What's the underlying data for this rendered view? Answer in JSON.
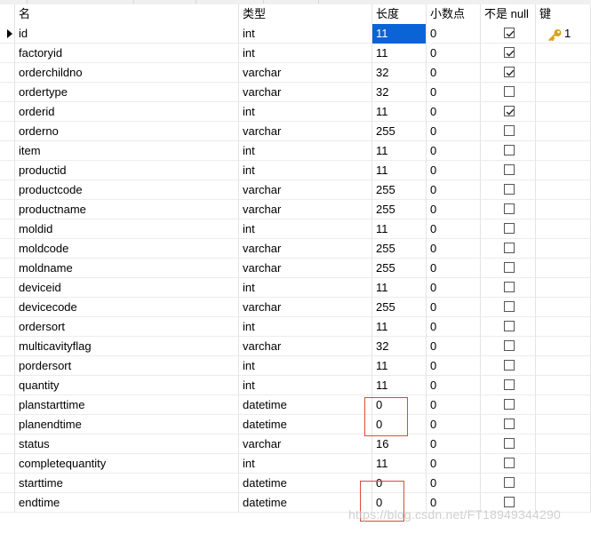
{
  "columns": {
    "name": "名",
    "type": "类型",
    "length": "长度",
    "decimals": "小数点",
    "not_null": "不是 null",
    "key": "键"
  },
  "fields": [
    {
      "name": "id",
      "type": "int",
      "length": "11",
      "decimals": "0",
      "not_null": true,
      "key": "1",
      "selected": true
    },
    {
      "name": "factoryid",
      "type": "int",
      "length": "11",
      "decimals": "0",
      "not_null": true,
      "key": ""
    },
    {
      "name": "orderchildno",
      "type": "varchar",
      "length": "32",
      "decimals": "0",
      "not_null": true,
      "key": ""
    },
    {
      "name": "ordertype",
      "type": "varchar",
      "length": "32",
      "decimals": "0",
      "not_null": false,
      "key": ""
    },
    {
      "name": "orderid",
      "type": "int",
      "length": "11",
      "decimals": "0",
      "not_null": true,
      "key": ""
    },
    {
      "name": "orderno",
      "type": "varchar",
      "length": "255",
      "decimals": "0",
      "not_null": false,
      "key": ""
    },
    {
      "name": "item",
      "type": "int",
      "length": "11",
      "decimals": "0",
      "not_null": false,
      "key": ""
    },
    {
      "name": "productid",
      "type": "int",
      "length": "11",
      "decimals": "0",
      "not_null": false,
      "key": ""
    },
    {
      "name": "productcode",
      "type": "varchar",
      "length": "255",
      "decimals": "0",
      "not_null": false,
      "key": ""
    },
    {
      "name": "productname",
      "type": "varchar",
      "length": "255",
      "decimals": "0",
      "not_null": false,
      "key": ""
    },
    {
      "name": "moldid",
      "type": "int",
      "length": "11",
      "decimals": "0",
      "not_null": false,
      "key": ""
    },
    {
      "name": "moldcode",
      "type": "varchar",
      "length": "255",
      "decimals": "0",
      "not_null": false,
      "key": ""
    },
    {
      "name": "moldname",
      "type": "varchar",
      "length": "255",
      "decimals": "0",
      "not_null": false,
      "key": ""
    },
    {
      "name": "deviceid",
      "type": "int",
      "length": "11",
      "decimals": "0",
      "not_null": false,
      "key": ""
    },
    {
      "name": "devicecode",
      "type": "varchar",
      "length": "255",
      "decimals": "0",
      "not_null": false,
      "key": ""
    },
    {
      "name": "ordersort",
      "type": "int",
      "length": "11",
      "decimals": "0",
      "not_null": false,
      "key": ""
    },
    {
      "name": "multicavityflag",
      "type": "varchar",
      "length": "32",
      "decimals": "0",
      "not_null": false,
      "key": ""
    },
    {
      "name": "pordersort",
      "type": "int",
      "length": "11",
      "decimals": "0",
      "not_null": false,
      "key": ""
    },
    {
      "name": "quantity",
      "type": "int",
      "length": "11",
      "decimals": "0",
      "not_null": false,
      "key": ""
    },
    {
      "name": "planstarttime",
      "type": "datetime",
      "length": "0",
      "decimals": "0",
      "not_null": false,
      "key": ""
    },
    {
      "name": "planendtime",
      "type": "datetime",
      "length": "0",
      "decimals": "0",
      "not_null": false,
      "key": ""
    },
    {
      "name": "status",
      "type": "varchar",
      "length": "16",
      "decimals": "0",
      "not_null": false,
      "key": ""
    },
    {
      "name": "completequantity",
      "type": "int",
      "length": "11",
      "decimals": "0",
      "not_null": false,
      "key": ""
    },
    {
      "name": "starttime",
      "type": "datetime",
      "length": "0",
      "decimals": "0",
      "not_null": false,
      "key": ""
    },
    {
      "name": "endtime",
      "type": "datetime",
      "length": "0",
      "decimals": "0",
      "not_null": false,
      "key": ""
    }
  ],
  "watermark": "https://blog.csdn.net/FT18949344290",
  "icons": {
    "row_indicator": "triangle-right-icon",
    "primary_key": "key-icon",
    "checkbox": "checkbox-icon"
  },
  "colors": {
    "selection": "#0a64d6",
    "annotation_box": "#e0463e",
    "key_gold": "#d9a21b"
  }
}
